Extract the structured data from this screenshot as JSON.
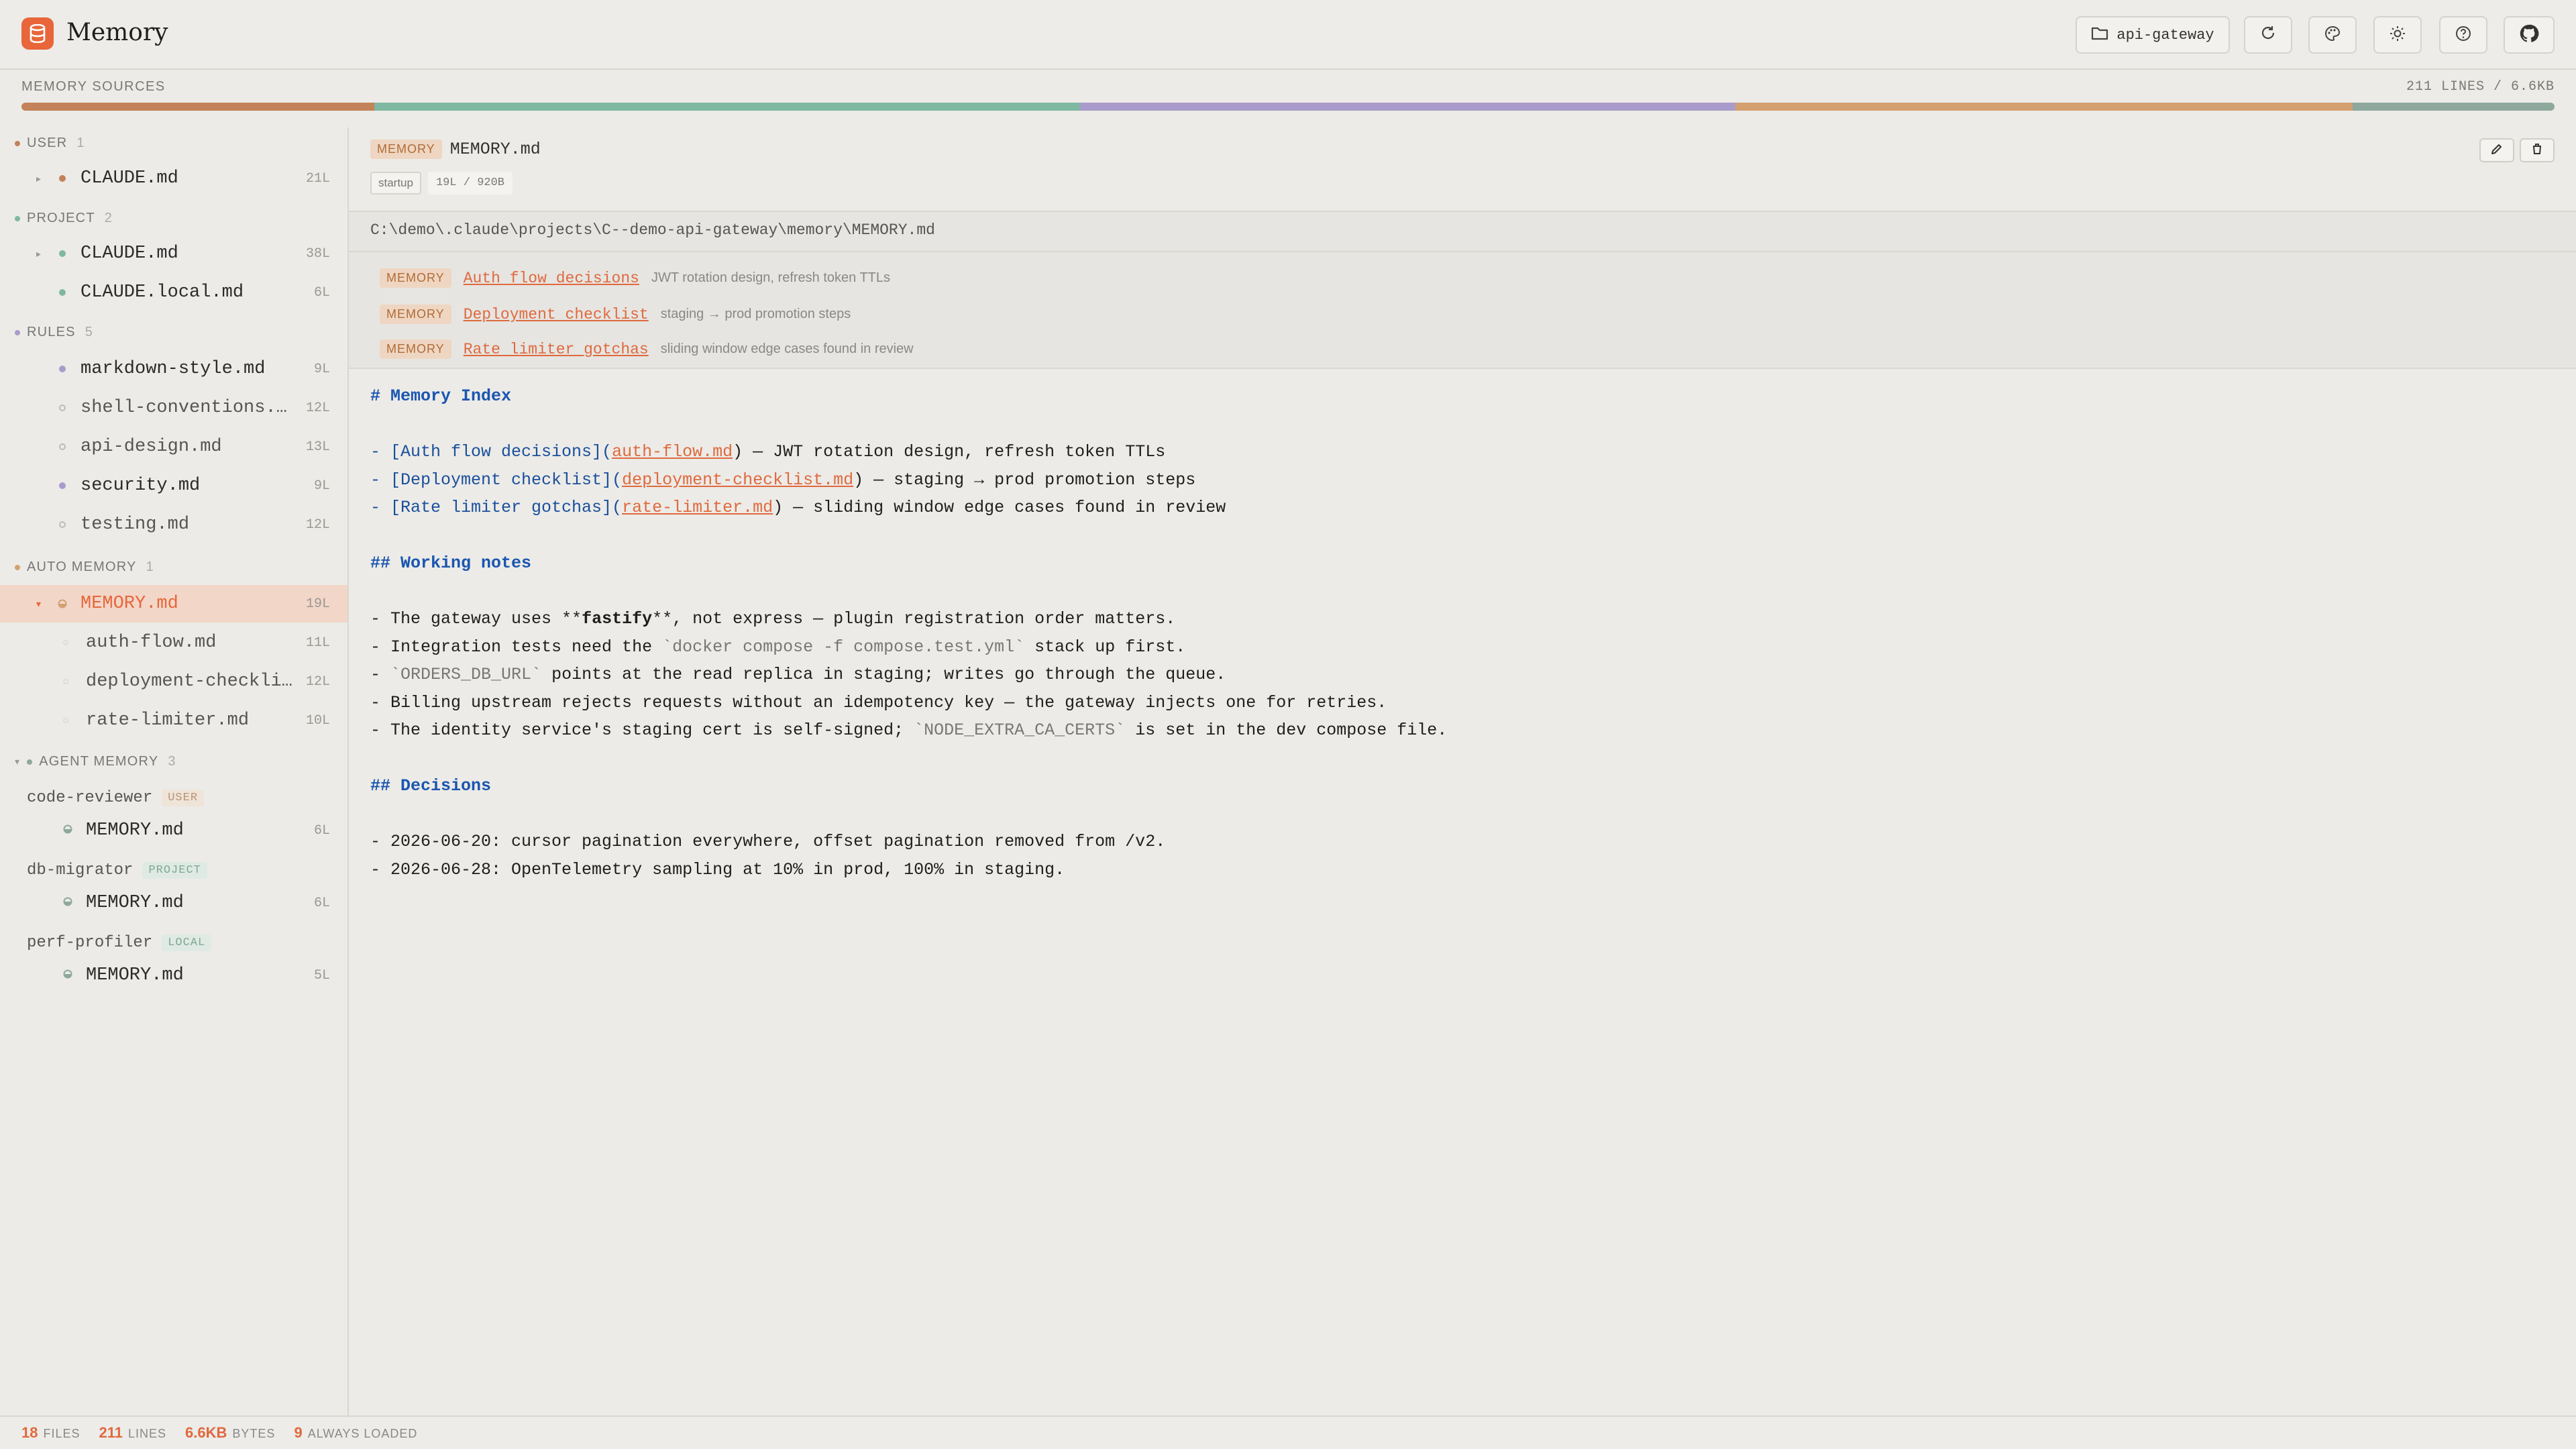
{
  "app": {
    "title": "Memory"
  },
  "header": {
    "project_label": "api-gateway"
  },
  "sources": {
    "label": "MEMORY SOURCES",
    "stats": "211 LINES / 6.6KB",
    "segments": [
      {
        "name": "user",
        "color": "#c4825a",
        "share": 14
      },
      {
        "name": "project",
        "color": "#7fb8a2",
        "share": 28
      },
      {
        "name": "rules",
        "color": "#a99bcb",
        "share": 26
      },
      {
        "name": "auto-memory",
        "color": "#d4a070",
        "share": 24.5
      },
      {
        "name": "agent-memory",
        "color": "#8ea89e",
        "share": 8
      }
    ]
  },
  "sidebar": {
    "user": {
      "label": "USER",
      "count": "1",
      "items": [
        {
          "name": "CLAUDE.md",
          "lines": "21L"
        }
      ]
    },
    "project": {
      "label": "PROJECT",
      "count": "2",
      "items": [
        {
          "name": "CLAUDE.md",
          "lines": "38L"
        },
        {
          "name": "CLAUDE.local.md",
          "lines": "6L"
        }
      ]
    },
    "rules": {
      "label": "RULES",
      "count": "5",
      "items": [
        {
          "name": "markdown-style.md",
          "lines": "9L"
        },
        {
          "name": "shell-conventions.md",
          "lines": "12L"
        },
        {
          "name": "api-design.md",
          "lines": "13L"
        },
        {
          "name": "security.md",
          "lines": "9L"
        },
        {
          "name": "testing.md",
          "lines": "12L"
        }
      ]
    },
    "auto": {
      "label": "AUTO MEMORY",
      "count": "1",
      "items": [
        {
          "name": "MEMORY.md",
          "lines": "19L"
        },
        {
          "name": "auth-flow.md",
          "lines": "11L"
        },
        {
          "name": "deployment-checklist.md",
          "lines": "12L"
        },
        {
          "name": "rate-limiter.md",
          "lines": "10L"
        }
      ]
    },
    "agent": {
      "label": "AGENT MEMORY",
      "count": "3",
      "agents": [
        {
          "name": "code-reviewer",
          "tag": "USER",
          "file": "MEMORY.md",
          "lines": "6L"
        },
        {
          "name": "db-migrator",
          "tag": "PROJECT",
          "file": "MEMORY.md",
          "lines": "6L"
        },
        {
          "name": "perf-profiler",
          "tag": "LOCAL",
          "file": "MEMORY.md",
          "lines": "5L"
        }
      ]
    }
  },
  "file": {
    "badge": "MEMORY",
    "name": "MEMORY.md",
    "chip_startup": "startup",
    "chip_size": "19L / 920B",
    "path": "C:\\demo\\.claude\\projects\\C--demo-api-gateway\\memory\\MEMORY.md",
    "links": [
      {
        "badge": "MEMORY",
        "title": "Auth flow decisions",
        "desc": "JWT rotation design, refresh token TTLs"
      },
      {
        "badge": "MEMORY",
        "title": "Deployment checklist",
        "desc": "staging → prod promotion steps"
      },
      {
        "badge": "MEMORY",
        "title": "Rate limiter gotchas",
        "desc": "sliding window edge cases found in review"
      }
    ]
  },
  "content": {
    "h1": "# Memory Index",
    "l1a": "- [Auth flow decisions](",
    "l1b": "auth-flow.md",
    "l1c": ") — JWT rotation design, refresh token TTLs",
    "l2a": "- [Deployment checklist](",
    "l2b": "deployment-checklist.md",
    "l2c": ") — staging → prod promotion steps",
    "l3a": "- [Rate limiter gotchas](",
    "l3b": "rate-limiter.md",
    "l3c": ") — sliding window edge cases found in review",
    "h2": "## Working notes",
    "n1a": "- The gateway uses **",
    "n1b": "fastify",
    "n1c": "**, not express — plugin registration order matters.",
    "n2a": "- Integration tests need the ",
    "n2b": "`docker compose -f compose.test.yml`",
    "n2c": " stack up first.",
    "n3a": "- ",
    "n3b": "`ORDERS_DB_URL`",
    "n3c": " points at the read replica in staging; writes go through the queue.",
    "n4": "- Billing upstream rejects requests without an idempotency key — the gateway injects one for retries.",
    "n5a": "- The identity service's staging cert is self-signed; ",
    "n5b": "`NODE_EXTRA_CA_CERTS`",
    "n5c": " is set in the dev compose file.",
    "h3": "## Decisions",
    "d1": "- 2026-06-20: cursor pagination everywhere, offset pagination removed from /v2.",
    "d2": "- 2026-06-28: OpenTelemetry sampling at 10% in prod, 100% in staging."
  },
  "footer": {
    "files": "18",
    "files_label": "FILES",
    "lines": "211",
    "lines_label": "LINES",
    "bytes": "6.6KB",
    "bytes_label": "BYTES",
    "always": "9",
    "always_label": "ALWAYS LOADED"
  }
}
